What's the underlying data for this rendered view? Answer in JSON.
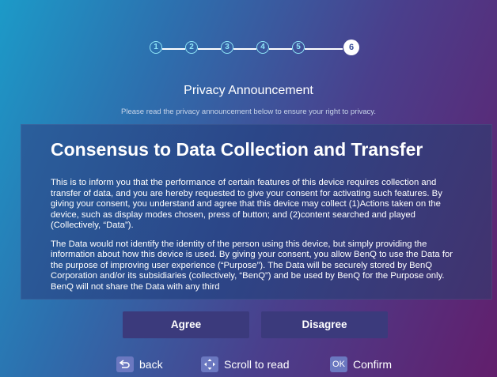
{
  "stepper": {
    "steps": [
      "1",
      "2",
      "3",
      "4",
      "5",
      "6"
    ],
    "current_step": 6
  },
  "header": {
    "title": "Privacy Announcement",
    "subtitle": "Please read the privacy announcement below to ensure your right to privacy."
  },
  "announcement": {
    "heading": "Consensus to Data Collection and Transfer",
    "paragraphs": [
      "This is to inform you that the performance of certain features of this device requires collection and transfer of data, and you are hereby requested to give your consent for activating such features. By giving your consent, you understand and agree that this device may collect (1)Actions taken on the device, such as display modes chosen, press of button; and (2)content searched and played (Collectively, “Data”).",
      "The Data would not identify the identity of the person using this device, but simply providing the information about how this device is used. By giving your consent, you allow BenQ to use the Data for the purpose of improving user experience (“Purpose”). The Data will be securely stored by BenQ Corporation and/or its subsidiaries (collectively, “BenQ”) and be used by BenQ for the Purpose only. BenQ will not share the Data with any third"
    ]
  },
  "buttons": {
    "agree": "Agree",
    "disagree": "Disagree"
  },
  "hints": {
    "back": "back",
    "scroll": "Scroll to read",
    "confirm": "Confirm",
    "ok_key": "OK"
  },
  "colors": {
    "button_bg": "#3b3a7c",
    "step_outline": "#8fe6f8",
    "hint_icon_bg": "#6b78c0"
  }
}
